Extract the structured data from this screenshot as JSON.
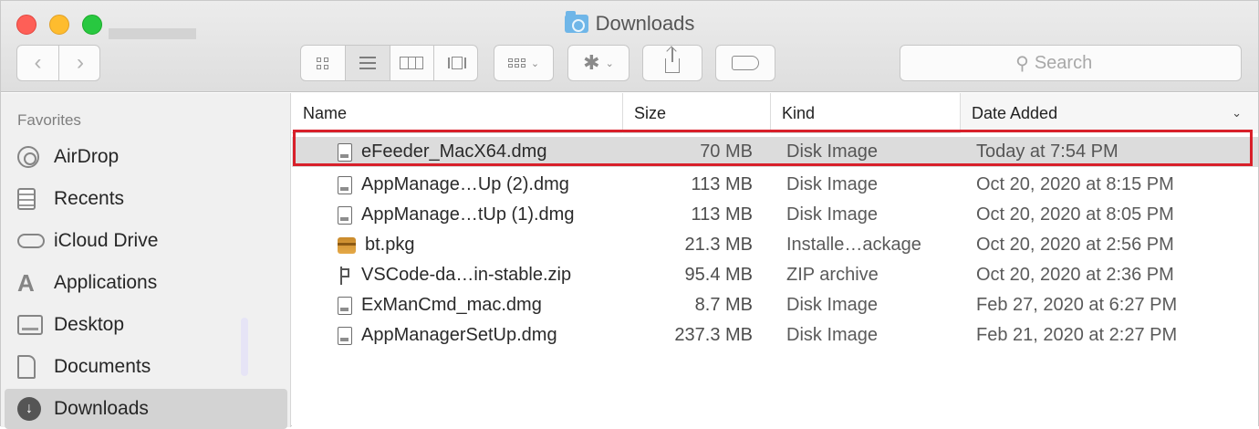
{
  "window": {
    "title": "Downloads"
  },
  "toolbar": {
    "back_label": "‹",
    "forward_label": "›",
    "arrange_caret": "⌄",
    "action_caret": "⌄",
    "action_gear": "✱",
    "search_placeholder": "Search",
    "search_icon": "⚲"
  },
  "sidebar": {
    "header": "Favorites",
    "items": [
      {
        "label": "AirDrop",
        "icon": "airdrop-icon"
      },
      {
        "label": "Recents",
        "icon": "recents-icon"
      },
      {
        "label": "iCloud Drive",
        "icon": "icloud-drive-icon"
      },
      {
        "label": "Applications",
        "icon": "applications-icon",
        "glyph": "A"
      },
      {
        "label": "Desktop",
        "icon": "desktop-icon"
      },
      {
        "label": "Documents",
        "icon": "documents-icon"
      },
      {
        "label": "Downloads",
        "icon": "downloads-icon",
        "glyph": "↓",
        "selected": true
      }
    ]
  },
  "columns": {
    "name": "Name",
    "size": "Size",
    "kind": "Kind",
    "date": "Date Added",
    "sort_caret": "⌄"
  },
  "files": [
    {
      "name": "eFeeder_MacX64.dmg",
      "size": "70 MB",
      "kind": "Disk Image",
      "date": "Today at 7:54 PM",
      "icon": "disk-image-icon",
      "selected": true
    },
    {
      "name": "AppManage…Up (2).dmg",
      "size": "113 MB",
      "kind": "Disk Image",
      "date": "Oct 20, 2020 at 8:15 PM",
      "icon": "disk-image-icon"
    },
    {
      "name": "AppManage…tUp (1).dmg",
      "size": "113 MB",
      "kind": "Disk Image",
      "date": "Oct 20, 2020 at 8:05 PM",
      "icon": "disk-image-icon"
    },
    {
      "name": "bt.pkg",
      "size": "21.3 MB",
      "kind": "Installe…ackage",
      "date": "Oct 20, 2020 at 2:56 PM",
      "icon": "package-icon"
    },
    {
      "name": "VSCode-da…in-stable.zip",
      "size": "95.4 MB",
      "kind": "ZIP archive",
      "date": "Oct 20, 2020 at 2:36 PM",
      "icon": "zip-archive-icon"
    },
    {
      "name": "ExManCmd_mac.dmg",
      "size": "8.7 MB",
      "kind": "Disk Image",
      "date": "Feb 27, 2020 at 6:27 PM",
      "icon": "disk-image-icon"
    },
    {
      "name": "AppManagerSetUp.dmg",
      "size": "237.3 MB",
      "kind": "Disk Image",
      "date": "Feb 21, 2020 at 2:27 PM",
      "icon": "disk-image-icon"
    }
  ],
  "colors": {
    "highlight": "#d8202a",
    "selection": "#dcdcdc",
    "sidebar_bg": "#f0f0f0"
  }
}
